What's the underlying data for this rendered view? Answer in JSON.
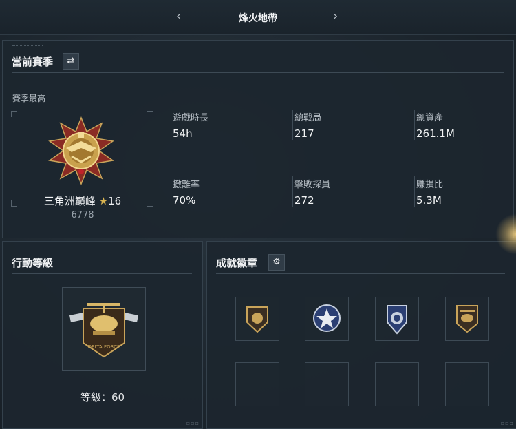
{
  "header": {
    "title": "烽火地帶",
    "prev_icon": "chevron-left-icon",
    "next_icon": "chevron-right-icon"
  },
  "season": {
    "title": "當前賽季",
    "switch_icon": "swap-arrows-icon",
    "subtitle": "賽季最高",
    "rank_name": "三角洲巔峰",
    "rank_star": "★",
    "rank_stars": "16",
    "rank_score": "6778",
    "stats": [
      {
        "label": "遊戲時長",
        "value": "54h"
      },
      {
        "label": "總戰局",
        "value": "217"
      },
      {
        "label": "總資產",
        "value": "261.1M"
      },
      {
        "label": "撤離率",
        "value": "70%"
      },
      {
        "label": "擊敗探員",
        "value": "272"
      },
      {
        "label": "賺損比",
        "value": "5.3M"
      }
    ]
  },
  "operations": {
    "title": "行動等級",
    "level_label": "等級：",
    "level_value": "60",
    "emblem_text": "DELTA FORCE"
  },
  "achievements": {
    "title": "成就徽章",
    "settings_icon": "gear-icon",
    "badges": [
      "lion-shield-badge",
      "star-wings-badge",
      "police-shield-badge",
      "helicopter-badge"
    ]
  },
  "colors": {
    "accent_gold": "#d9b451",
    "panel_bg": "#1c262f",
    "border": "#34414c"
  }
}
